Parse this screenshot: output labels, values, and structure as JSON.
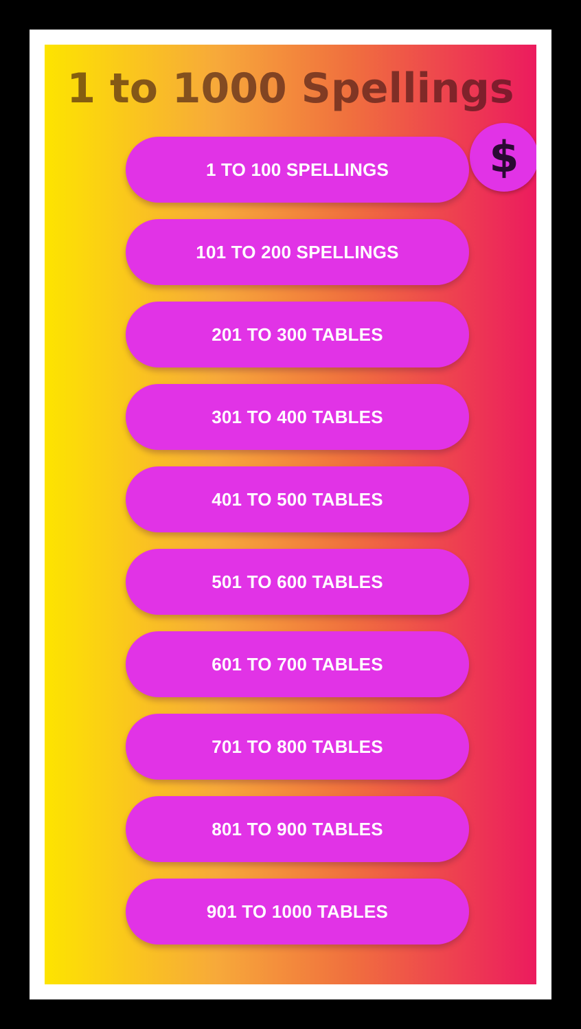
{
  "title": "1 to 1000 Spellings",
  "coin_icon": {
    "icon": "dollar-icon",
    "glyph": "$"
  },
  "colors": {
    "gradient_start": "#fde400",
    "gradient_end": "#ec1b5e",
    "button": "#e133e6",
    "button_text": "#ffffff"
  },
  "buttons": [
    {
      "label": "1 TO 100 SPELLINGS"
    },
    {
      "label": "101 TO 200 SPELLINGS"
    },
    {
      "label": "201 TO 300 TABLES"
    },
    {
      "label": "301 TO 400 TABLES"
    },
    {
      "label": "401 TO 500 TABLES"
    },
    {
      "label": "501 TO 600 TABLES"
    },
    {
      "label": "601 TO 700 TABLES"
    },
    {
      "label": "701 TO 800 TABLES"
    },
    {
      "label": "801 TO 900 TABLES"
    },
    {
      "label": "901 TO 1000 TABLES"
    }
  ]
}
